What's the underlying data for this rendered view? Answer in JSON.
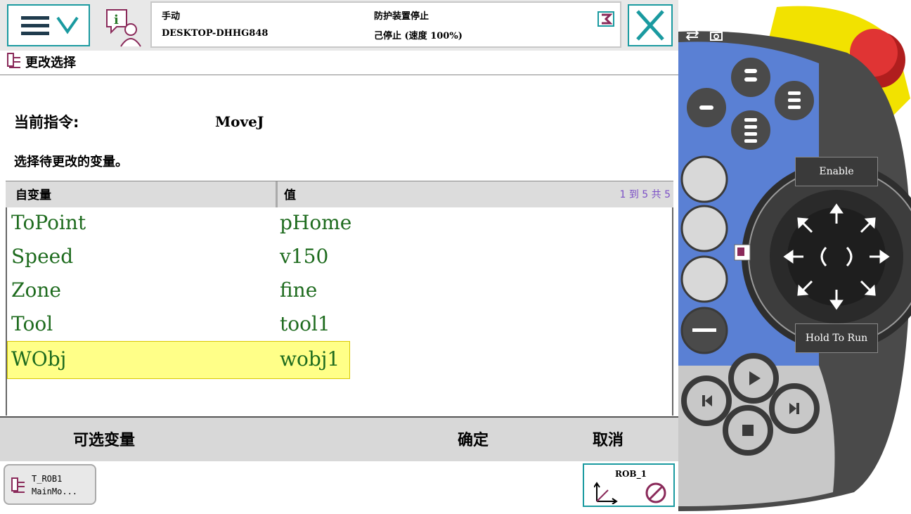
{
  "header": {
    "mode": "手动",
    "host": "DESKTOP-DHHG848",
    "state": "防护装置停止",
    "speed_state": "己停止 (速度 100%)"
  },
  "window_title": "更改选择",
  "current_instruction": {
    "label": "当前指令:",
    "value": "MoveJ"
  },
  "instruction_hint": "选择待更改的变量。",
  "table": {
    "col_argument": "自变量",
    "col_value": "值",
    "pager": "1 到 5 共 5",
    "rows": [
      {
        "argument": "ToPoint",
        "value": "pHome"
      },
      {
        "argument": "Speed",
        "value": "v150"
      },
      {
        "argument": "Zone",
        "value": "fine"
      },
      {
        "argument": "Tool",
        "value": "tool1"
      },
      {
        "argument": "WObj",
        "value": "wobj1",
        "selected": true
      }
    ]
  },
  "bottom": {
    "optional_label": "可选变量",
    "ok_label": "确定",
    "cancel_label": "取消"
  },
  "taskbar": {
    "task_line1": "T_ROB1",
    "task_line2": "MainMo...",
    "robot": "ROB_1"
  },
  "flexpendant": {
    "enable_label": "Enable",
    "hold_to_run_label": "Hold To Run"
  },
  "colors": {
    "accent": "#1a9aa0",
    "row_text": "#1e6b1e",
    "selected_row": "#ffff88",
    "pendant_blue": "#4a7bd6",
    "pendant_dark": "#3d3d3d",
    "pendant_yellow": "#f2e200",
    "estop_red": "#d42a2a"
  }
}
